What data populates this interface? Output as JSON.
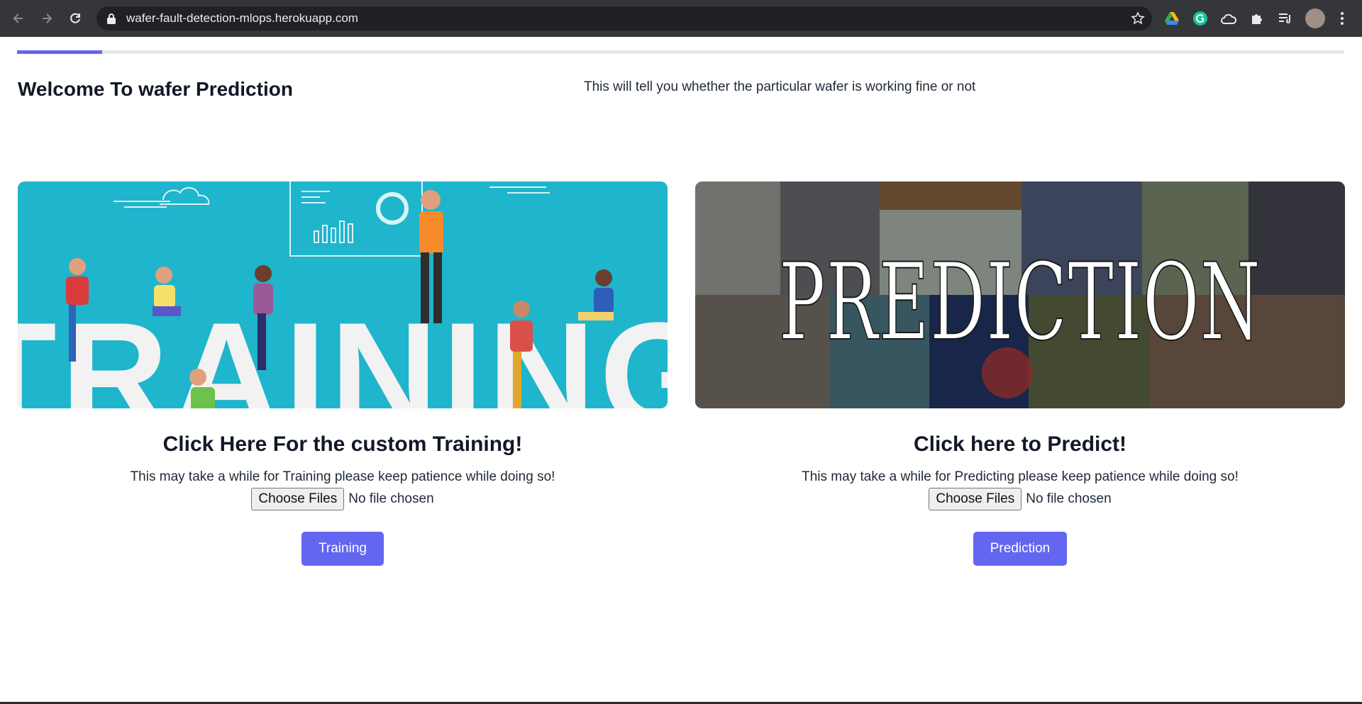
{
  "browser": {
    "url": "wafer-fault-detection-mlops.herokuapp.com",
    "icons": [
      "back-arrow-icon",
      "forward-arrow-icon",
      "reload-icon",
      "lock-icon",
      "star-icon",
      "google-drive-icon",
      "grammarly-icon",
      "cloud-extension-icon",
      "puzzle-extensions-icon",
      "reading-list-icon",
      "profile-avatar",
      "kebab-menu-icon"
    ]
  },
  "progress": {
    "fraction": 0.064,
    "color": "#6366f1"
  },
  "header": {
    "title": "Welcome To wafer Prediction",
    "subtitle": "This will tell you whether the particular wafer is working fine or not"
  },
  "training": {
    "hero_text": "TRAINING",
    "heading": "Click Here For the custom Training!",
    "description": "This may take a while for Training please keep patience while doing so!",
    "file_button": "Choose Files",
    "file_status": "No file chosen",
    "action_label": "Training"
  },
  "prediction": {
    "hero_text": "PREDICTION",
    "heading": "Click here to Predict!",
    "description": "This may take a while for Predicting please keep patience while doing so!",
    "file_button": "Choose Files",
    "file_status": "No file chosen",
    "action_label": "Prediction"
  },
  "colors": {
    "accent": "#6366f1",
    "training_bg": "#1fb5cc",
    "chrome": "#35363a"
  }
}
